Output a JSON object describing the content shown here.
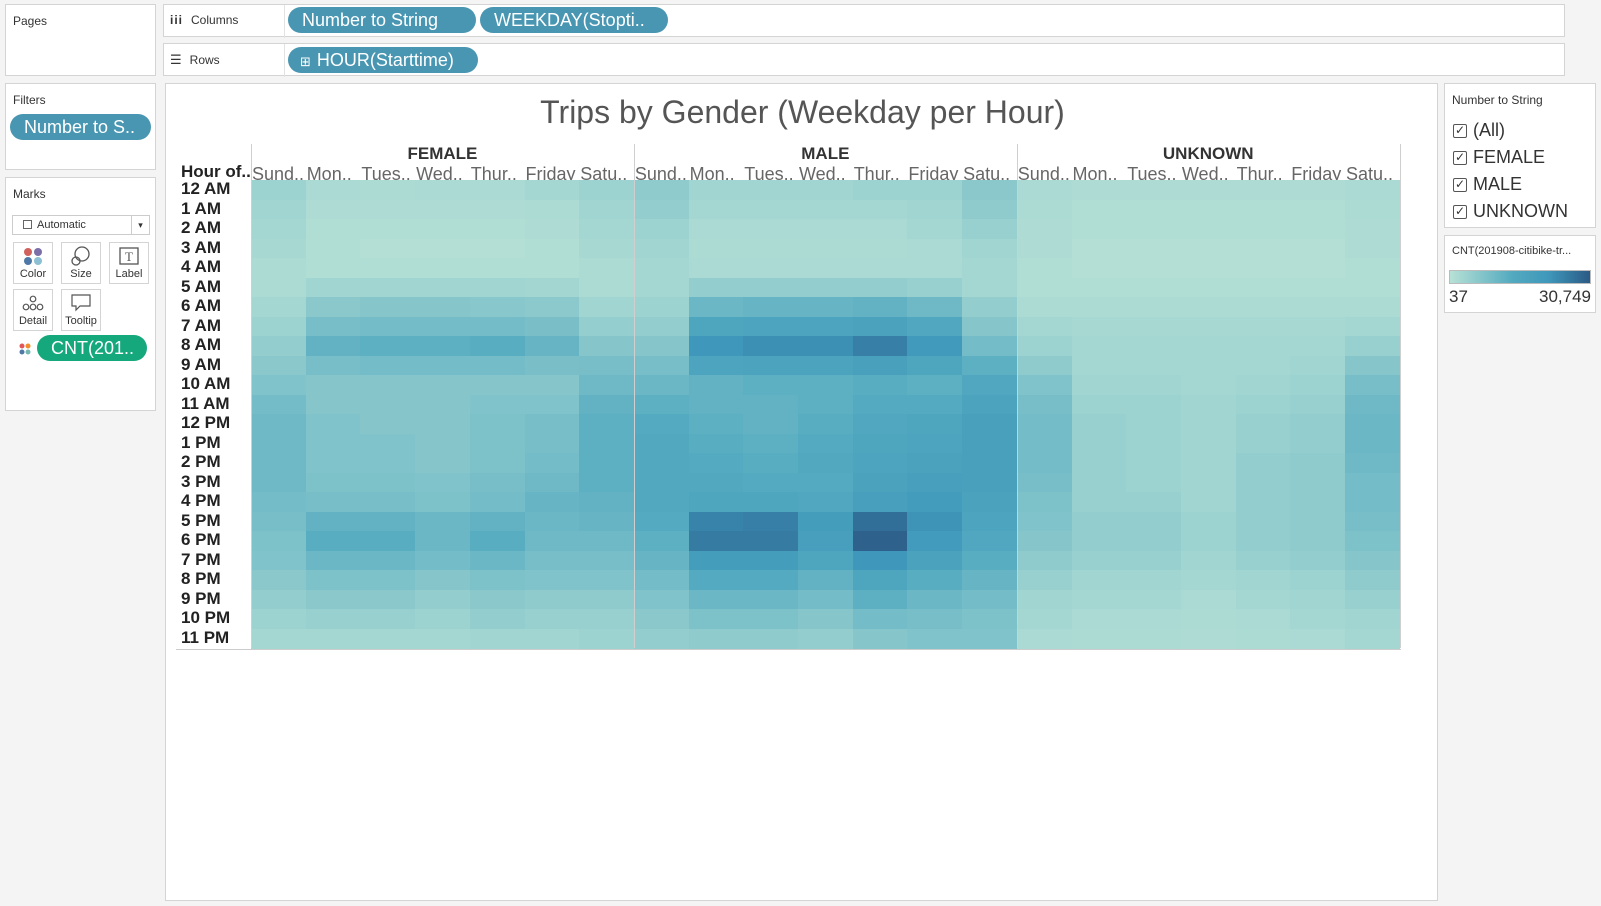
{
  "shelves": {
    "pages_label": "Pages",
    "columns_label": "Columns",
    "rows_label": "Rows",
    "columns_pills": [
      "Number to String",
      "WEEKDAY(Stopti.."
    ],
    "rows_pills": [
      "HOUR(Starttime)"
    ]
  },
  "filters": {
    "label": "Filters",
    "pill": "Number to S.."
  },
  "marks": {
    "label": "Marks",
    "type": "Automatic",
    "buttons": [
      "Color",
      "Size",
      "Label",
      "Detail",
      "Tooltip"
    ],
    "pill": "CNT(201.."
  },
  "legend": {
    "filter_title": "Number to String",
    "items": [
      "(All)",
      "FEMALE",
      "MALE",
      "UNKNOWN"
    ],
    "color_title": "CNT(201908-citibike-tr...",
    "min": "37",
    "max": "30,749",
    "color_low": "#b7e1d6",
    "color_high": "#2b5a86"
  },
  "chart_data": {
    "type": "heatmap",
    "title": "Trips by Gender (Weekday per Hour)",
    "row_header": "Hour of..",
    "groups": [
      "FEMALE",
      "MALE",
      "UNKNOWN"
    ],
    "days": [
      "Sund..",
      "Mon..",
      "Tues..",
      "Wed..",
      "Thur..",
      "Friday",
      "Satu.."
    ],
    "hours": [
      "12 AM",
      "1 AM",
      "2 AM",
      "3 AM",
      "4 AM",
      "5 AM",
      "6 AM",
      "7 AM",
      "8 AM",
      "9 AM",
      "10 AM",
      "11 AM",
      "12 PM",
      "1 PM",
      "2 PM",
      "3 PM",
      "4 PM",
      "5 PM",
      "6 PM",
      "7 PM",
      "8 PM",
      "9 PM",
      "10 PM",
      "11 PM"
    ],
    "range": [
      37,
      30749
    ],
    "values": {
      "FEMALE": [
        [
          0.12,
          0.06,
          0.05,
          0.06,
          0.06,
          0.08,
          0.12
        ],
        [
          0.1,
          0.04,
          0.04,
          0.04,
          0.04,
          0.05,
          0.1
        ],
        [
          0.08,
          0.03,
          0.03,
          0.03,
          0.03,
          0.04,
          0.08
        ],
        [
          0.07,
          0.03,
          0.02,
          0.02,
          0.02,
          0.03,
          0.07
        ],
        [
          0.05,
          0.03,
          0.03,
          0.03,
          0.03,
          0.03,
          0.05
        ],
        [
          0.05,
          0.1,
          0.1,
          0.1,
          0.1,
          0.09,
          0.05
        ],
        [
          0.08,
          0.2,
          0.22,
          0.22,
          0.21,
          0.19,
          0.1
        ],
        [
          0.12,
          0.28,
          0.3,
          0.3,
          0.3,
          0.27,
          0.15
        ],
        [
          0.16,
          0.38,
          0.4,
          0.4,
          0.42,
          0.36,
          0.22
        ],
        [
          0.2,
          0.28,
          0.3,
          0.3,
          0.3,
          0.27,
          0.28
        ],
        [
          0.24,
          0.22,
          0.22,
          0.22,
          0.22,
          0.22,
          0.32
        ],
        [
          0.3,
          0.22,
          0.22,
          0.22,
          0.24,
          0.24,
          0.38
        ],
        [
          0.32,
          0.24,
          0.22,
          0.22,
          0.26,
          0.28,
          0.4
        ],
        [
          0.32,
          0.24,
          0.24,
          0.22,
          0.26,
          0.28,
          0.4
        ],
        [
          0.32,
          0.24,
          0.24,
          0.22,
          0.26,
          0.3,
          0.4
        ],
        [
          0.32,
          0.26,
          0.26,
          0.24,
          0.28,
          0.32,
          0.4
        ],
        [
          0.3,
          0.28,
          0.28,
          0.26,
          0.3,
          0.36,
          0.38
        ],
        [
          0.28,
          0.38,
          0.38,
          0.34,
          0.38,
          0.34,
          0.36
        ],
        [
          0.26,
          0.42,
          0.42,
          0.34,
          0.42,
          0.32,
          0.32
        ],
        [
          0.24,
          0.34,
          0.34,
          0.3,
          0.34,
          0.28,
          0.28
        ],
        [
          0.2,
          0.26,
          0.26,
          0.22,
          0.26,
          0.24,
          0.24
        ],
        [
          0.16,
          0.2,
          0.2,
          0.16,
          0.2,
          0.18,
          0.18
        ],
        [
          0.12,
          0.14,
          0.14,
          0.12,
          0.16,
          0.14,
          0.14
        ],
        [
          0.08,
          0.08,
          0.08,
          0.08,
          0.1,
          0.1,
          0.12
        ]
      ],
      "MALE": [
        [
          0.18,
          0.1,
          0.1,
          0.1,
          0.12,
          0.12,
          0.2
        ],
        [
          0.16,
          0.08,
          0.08,
          0.08,
          0.08,
          0.1,
          0.18
        ],
        [
          0.12,
          0.06,
          0.06,
          0.06,
          0.06,
          0.08,
          0.14
        ],
        [
          0.1,
          0.05,
          0.05,
          0.05,
          0.05,
          0.06,
          0.1
        ],
        [
          0.08,
          0.06,
          0.06,
          0.06,
          0.06,
          0.06,
          0.08
        ],
        [
          0.08,
          0.16,
          0.16,
          0.16,
          0.16,
          0.14,
          0.08
        ],
        [
          0.12,
          0.34,
          0.36,
          0.36,
          0.38,
          0.32,
          0.16
        ],
        [
          0.16,
          0.5,
          0.52,
          0.52,
          0.56,
          0.48,
          0.22
        ],
        [
          0.22,
          0.7,
          0.74,
          0.74,
          0.82,
          0.68,
          0.3
        ],
        [
          0.28,
          0.52,
          0.54,
          0.54,
          0.58,
          0.5,
          0.4
        ],
        [
          0.34,
          0.38,
          0.4,
          0.4,
          0.42,
          0.4,
          0.48
        ],
        [
          0.4,
          0.38,
          0.38,
          0.4,
          0.44,
          0.44,
          0.54
        ],
        [
          0.44,
          0.4,
          0.38,
          0.42,
          0.48,
          0.5,
          0.58
        ],
        [
          0.46,
          0.42,
          0.4,
          0.44,
          0.5,
          0.52,
          0.58
        ],
        [
          0.46,
          0.44,
          0.42,
          0.46,
          0.52,
          0.56,
          0.58
        ],
        [
          0.46,
          0.46,
          0.44,
          0.44,
          0.56,
          0.6,
          0.58
        ],
        [
          0.46,
          0.5,
          0.5,
          0.48,
          0.6,
          0.64,
          0.56
        ],
        [
          0.44,
          0.8,
          0.82,
          0.62,
          0.9,
          0.72,
          0.52
        ],
        [
          0.4,
          0.84,
          0.84,
          0.6,
          0.96,
          0.66,
          0.48
        ],
        [
          0.36,
          0.62,
          0.62,
          0.5,
          0.7,
          0.56,
          0.42
        ],
        [
          0.3,
          0.44,
          0.44,
          0.38,
          0.5,
          0.42,
          0.36
        ],
        [
          0.24,
          0.34,
          0.34,
          0.3,
          0.4,
          0.34,
          0.3
        ],
        [
          0.2,
          0.26,
          0.26,
          0.22,
          0.3,
          0.28,
          0.26
        ],
        [
          0.16,
          0.18,
          0.18,
          0.16,
          0.22,
          0.24,
          0.24
        ]
      ],
      "UNKNOWN": [
        [
          0.06,
          0.04,
          0.04,
          0.04,
          0.04,
          0.04,
          0.06
        ],
        [
          0.05,
          0.03,
          0.03,
          0.03,
          0.03,
          0.03,
          0.05
        ],
        [
          0.04,
          0.03,
          0.03,
          0.03,
          0.03,
          0.03,
          0.04
        ],
        [
          0.04,
          0.02,
          0.02,
          0.02,
          0.02,
          0.02,
          0.04
        ],
        [
          0.03,
          0.02,
          0.02,
          0.02,
          0.02,
          0.02,
          0.03
        ],
        [
          0.03,
          0.03,
          0.03,
          0.03,
          0.03,
          0.03,
          0.03
        ],
        [
          0.05,
          0.05,
          0.05,
          0.05,
          0.05,
          0.05,
          0.05
        ],
        [
          0.08,
          0.07,
          0.07,
          0.07,
          0.07,
          0.07,
          0.08
        ],
        [
          0.12,
          0.08,
          0.08,
          0.08,
          0.08,
          0.08,
          0.14
        ],
        [
          0.18,
          0.08,
          0.08,
          0.08,
          0.08,
          0.1,
          0.22
        ],
        [
          0.24,
          0.1,
          0.1,
          0.08,
          0.1,
          0.12,
          0.28
        ],
        [
          0.28,
          0.12,
          0.12,
          0.1,
          0.12,
          0.14,
          0.32
        ],
        [
          0.3,
          0.14,
          0.12,
          0.1,
          0.14,
          0.16,
          0.34
        ],
        [
          0.3,
          0.14,
          0.12,
          0.1,
          0.14,
          0.16,
          0.34
        ],
        [
          0.3,
          0.14,
          0.12,
          0.1,
          0.16,
          0.18,
          0.32
        ],
        [
          0.28,
          0.14,
          0.12,
          0.1,
          0.16,
          0.18,
          0.3
        ],
        [
          0.26,
          0.14,
          0.14,
          0.1,
          0.16,
          0.18,
          0.3
        ],
        [
          0.24,
          0.16,
          0.16,
          0.12,
          0.16,
          0.18,
          0.28
        ],
        [
          0.22,
          0.16,
          0.16,
          0.12,
          0.16,
          0.18,
          0.26
        ],
        [
          0.18,
          0.14,
          0.14,
          0.1,
          0.14,
          0.16,
          0.22
        ],
        [
          0.14,
          0.1,
          0.1,
          0.08,
          0.1,
          0.12,
          0.18
        ],
        [
          0.1,
          0.08,
          0.08,
          0.06,
          0.08,
          0.1,
          0.14
        ],
        [
          0.08,
          0.06,
          0.06,
          0.05,
          0.06,
          0.08,
          0.1
        ],
        [
          0.06,
          0.05,
          0.05,
          0.04,
          0.05,
          0.06,
          0.08
        ]
      ]
    }
  }
}
